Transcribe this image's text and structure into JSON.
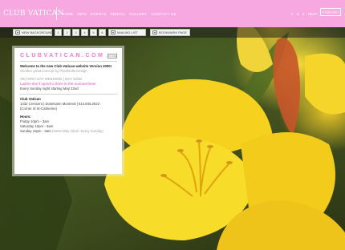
{
  "header": {
    "logo": "CLUB VATICAN",
    "nav": [
      "HOME",
      "INFO",
      "EVENTS",
      "RENTAL",
      "GALLERY",
      "CONTACT US"
    ],
    "lang": [
      "F",
      "E",
      "S",
      "HELP"
    ],
    "brand_mark": "|||||||||||||||||||"
  },
  "toolbar": {
    "new_background": "NEW BACKGROUND",
    "pages": [
      "1",
      "2",
      "3",
      "4",
      "5",
      "6"
    ],
    "mailing_list": "MAILING LIST",
    "bookmark": "BOOKMARK PAGE"
  },
  "panel": {
    "title": "CLUBVATICAN.COM",
    "close_label": "CLOSE",
    "welcome": "Welcome to the new Club Vatican website Version 2000!",
    "credit": "Another great concept by Pixelbrella Design",
    "event_heading": "VICTORIA DAY WEEKEND | MAY 22ND",
    "ladies_line": "Ladies don't spend a dime in the summertime!",
    "every_sunday": "Every Sunday night starting May 22nd",
    "venue_name": "Club Vatican",
    "address_1": "1432 Crescent | Downtown Montreal | 514.845.2622",
    "address_2": "(Corner of St-Catherine)",
    "hours_heading": "Hours:",
    "hours_fri": "Friday 10pm - 3am",
    "hours_sat": "Saturday 10pm - 3am",
    "hours_sun": "Sunday 10pm - 3am",
    "hours_sun_note": "(starts May 22nd / Every Sunday)"
  },
  "colors": {
    "header_pink": "#f7a8e0",
    "accent_pink": "#f07ad6"
  }
}
